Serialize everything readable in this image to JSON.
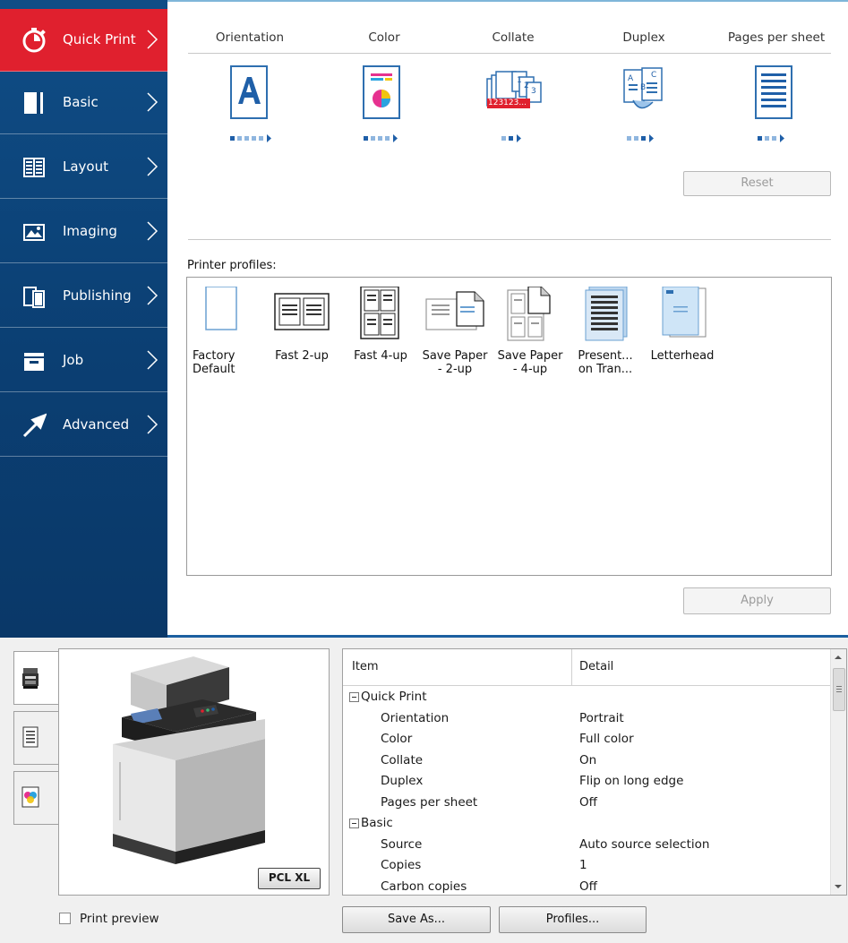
{
  "sidebar": {
    "items": [
      {
        "label": "Quick Print",
        "icon": "stopwatch-icon",
        "active": true
      },
      {
        "label": "Basic",
        "icon": "page-icon"
      },
      {
        "label": "Layout",
        "icon": "layout-grid-icon"
      },
      {
        "label": "Imaging",
        "icon": "image-icon"
      },
      {
        "label": "Publishing",
        "icon": "documents-icon"
      },
      {
        "label": "Job",
        "icon": "job-tray-icon"
      },
      {
        "label": "Advanced",
        "icon": "arrow-icon"
      }
    ]
  },
  "quick_print": {
    "headers": [
      "Orientation",
      "Color",
      "Collate",
      "Duplex",
      "Pages per sheet"
    ],
    "collate_badge": "123123...",
    "reset_label": "Reset"
  },
  "profiles": {
    "label": "Printer profiles:",
    "items": [
      {
        "label": "Factory\nDefault",
        "icon": "blank-page-icon"
      },
      {
        "label": "Fast 2-up",
        "icon": "two-up-icon"
      },
      {
        "label": "Fast 4-up",
        "icon": "four-up-icon"
      },
      {
        "label": "Save Paper\n- 2-up",
        "icon": "save-paper-2up-icon"
      },
      {
        "label": "Save Paper\n- 4-up",
        "icon": "save-paper-4up-icon"
      },
      {
        "label": "Present...\non Tran...",
        "icon": "presentation-icon"
      },
      {
        "label": "Letterhead",
        "icon": "letterhead-icon"
      }
    ],
    "apply_label": "Apply"
  },
  "preview": {
    "pdl_badge": "PCL XL",
    "print_preview_label": "Print preview",
    "print_preview_checked": false
  },
  "details": {
    "columns": [
      "Item",
      "Detail"
    ],
    "rows": [
      {
        "item": "Quick Print",
        "detail": "",
        "group": true
      },
      {
        "item": "Orientation",
        "detail": "Portrait"
      },
      {
        "item": "Color",
        "detail": "Full color"
      },
      {
        "item": "Collate",
        "detail": "On"
      },
      {
        "item": "Duplex",
        "detail": "Flip on long edge"
      },
      {
        "item": "Pages per sheet",
        "detail": "Off"
      },
      {
        "item": "Basic",
        "detail": "",
        "group": true
      },
      {
        "item": "Source",
        "detail": "Auto source selection"
      },
      {
        "item": "Copies",
        "detail": "1"
      },
      {
        "item": "Carbon copies",
        "detail": "Off"
      }
    ]
  },
  "footer": {
    "save_as_label": "Save As...",
    "profiles_label": "Profiles..."
  },
  "colors": {
    "active": "#e0202e",
    "sidebar": "#0f4d86",
    "accent": "#1c5fa0"
  }
}
